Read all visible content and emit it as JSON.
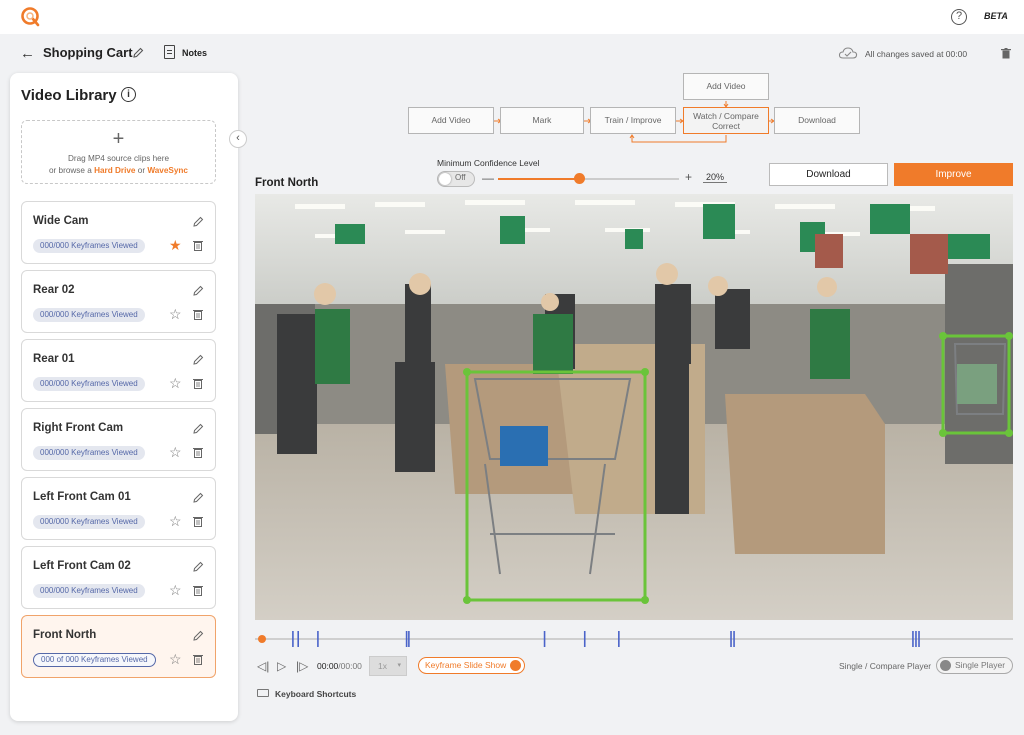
{
  "app": {
    "beta_label": "BETA",
    "help_label": "?",
    "logo_icon": "q-logo-icon",
    "accent_color": "#f07b2a"
  },
  "header": {
    "back_label": "←",
    "title": "Shopping Cart",
    "notes_label": "Notes",
    "saved_status": "All changes saved at 00:00"
  },
  "sidebar": {
    "title": "Video Library",
    "info_label": "i",
    "dropzone": {
      "line1": "Drag MP4 source clips here",
      "prefix": "or browse a",
      "link1": "Hard Drive",
      "or": "or",
      "link2": "WaveSync"
    },
    "collapse_label": "‹",
    "videos": [
      {
        "name": "Wide Cam",
        "badge": "000/000 Keyframes Viewed",
        "favorite": true,
        "selected": false
      },
      {
        "name": "Rear 02",
        "badge": "000/000 Keyframes Viewed",
        "favorite": false,
        "selected": false
      },
      {
        "name": "Rear 01",
        "badge": "000/000 Keyframes Viewed",
        "favorite": false,
        "selected": false
      },
      {
        "name": "Right Front Cam",
        "badge": "000/000 Keyframes Viewed",
        "favorite": false,
        "selected": false
      },
      {
        "name": "Left Front Cam 01",
        "badge": "000/000 Keyframes Viewed",
        "favorite": false,
        "selected": false
      },
      {
        "name": "Left Front Cam 02",
        "badge": "000/000 Keyframes Viewed",
        "favorite": false,
        "selected": false
      },
      {
        "name": "Front North",
        "badge": "000 of 000 Keyframes Viewed",
        "favorite": false,
        "selected": true
      }
    ]
  },
  "workflow": {
    "steps": {
      "add_video_top": "Add Video",
      "add_video": "Add Video",
      "mark": "Mark",
      "train": "Train / Improve",
      "watch_line1": "Watch / Compare",
      "watch_line2": "Correct",
      "download": "Download"
    }
  },
  "confidence": {
    "label": "Minimum Confidence Level",
    "toggle_label": "Off",
    "minus": "—",
    "plus": "+",
    "value_text": "20%",
    "slider_fraction": 0.45
  },
  "actions": {
    "download_label": "Download",
    "improve_label": "Improve"
  },
  "player": {
    "video_title": "Front North",
    "time_current": "00:00",
    "time_total": "/00:00",
    "speed": "1x",
    "speed_caret": "▾",
    "keyframe_toggle": "Keyframe Slide Show",
    "compare_label": "Single / Compare Player",
    "single_player_label": "Single Player",
    "keyboard_shortcuts": "Keyboard Shortcuts",
    "prev_icon": "◁|",
    "play_icon": "▷",
    "next_icon": "|▷",
    "keyframe_markers": [
      0.05,
      0.057,
      0.083,
      0.2,
      0.203,
      0.382,
      0.435,
      0.48,
      0.628,
      0.632,
      0.868,
      0.872,
      0.876
    ]
  },
  "detections": [
    {
      "label": "shopping-cart",
      "color": "#6ac43a"
    },
    {
      "label": "shopping-cart",
      "color": "#6ac43a"
    }
  ]
}
